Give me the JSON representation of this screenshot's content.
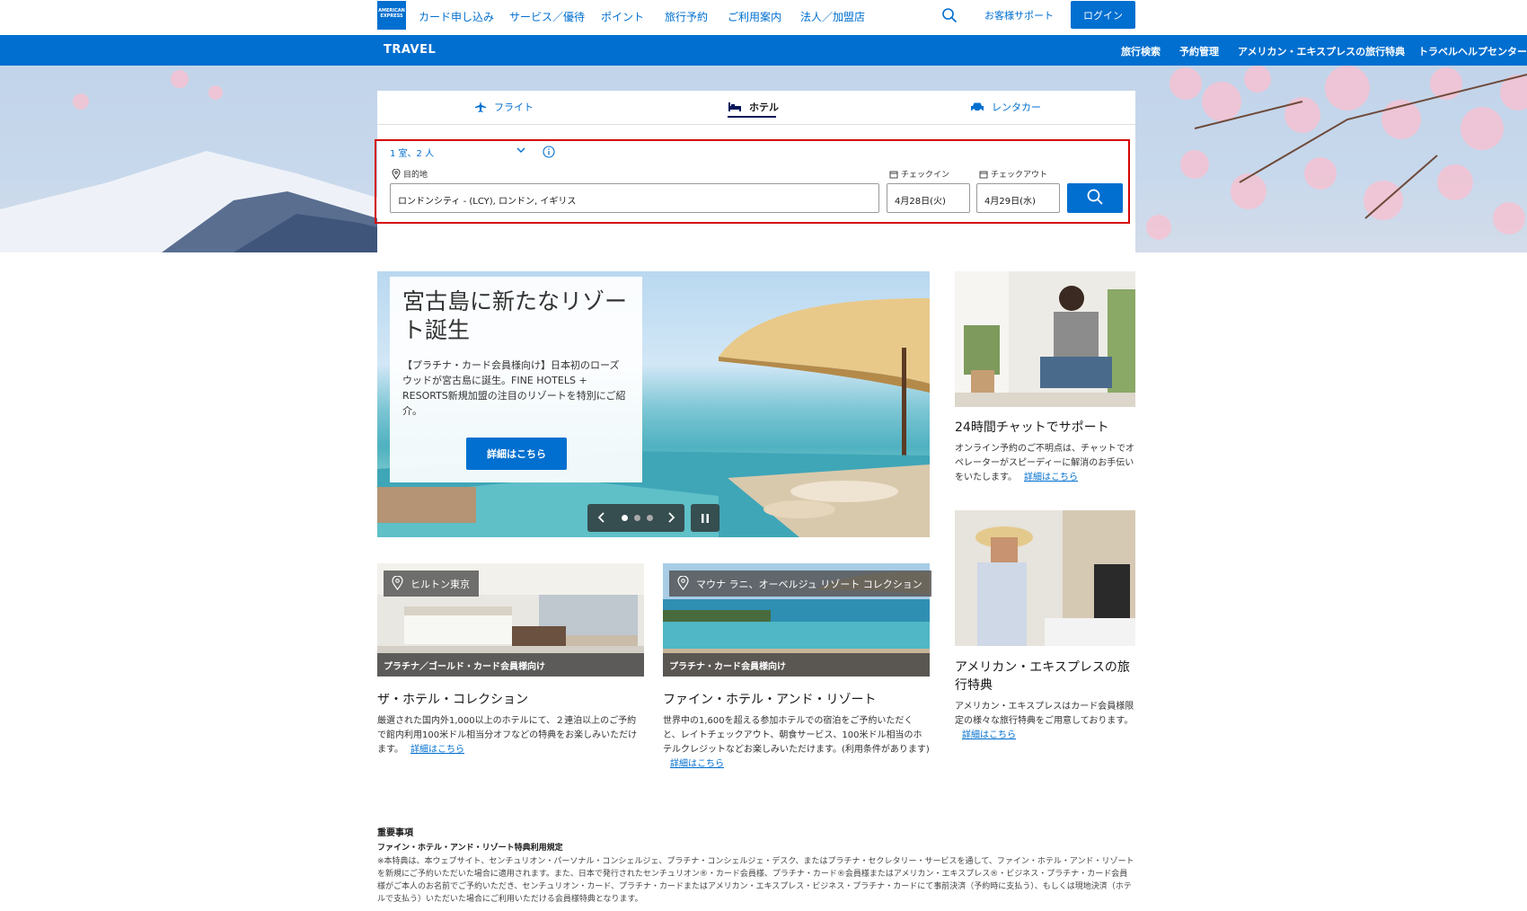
{
  "topnav": {
    "logo_text": "AMERICAN EXPRESS",
    "items": [
      "カード申し込み",
      "サービス／優待",
      "ポイント",
      "旅行予約",
      "ご利用案内",
      "法人／加盟店"
    ],
    "support": "お客様サポート",
    "login": "ログイン"
  },
  "travelbar": {
    "title": "TRAVEL",
    "items": [
      "旅行検索",
      "予約管理",
      "アメリカン・エキスプレスの旅行特典",
      "トラベルヘルプセンター"
    ]
  },
  "search": {
    "tabs": [
      {
        "label": "フライト",
        "icon": "airplane-icon"
      },
      {
        "label": "ホテル",
        "icon": "bed-icon"
      },
      {
        "label": "レンタカー",
        "icon": "car-icon"
      }
    ],
    "active_tab": "ホテル",
    "rooms_guests": "1 室、2 人",
    "destination_label": "目的地",
    "destination_value": "ロンドンシティ - (LCY), ロンドン, イギリス",
    "checkin_label": "チェックイン",
    "checkin_value": "4月28日(火)",
    "checkout_label": "チェックアウト",
    "checkout_value": "4月29日(水)"
  },
  "feature": {
    "title": "宮古島に新たなリゾート誕生",
    "description": "【プラチナ・カード会員様向け】日本初のローズウッドが宮古島に誕生。FINE HOTELS + RESORTS新規加盟の注目のリゾートを特別にご紹介。",
    "button": "詳細はこちら",
    "slides": 3,
    "current_slide": 1
  },
  "cards": [
    {
      "tag": "ヒルトン東京",
      "band": "プラチナ／ゴールド・カード会員様向け",
      "title": "ザ・ホテル・コレクション",
      "desc": "厳選された国内外1,000以上のホテルにて、２連泊以上のご予約で館内利用100米ドル相当分オフなどの特典をお楽しみいただけます。",
      "link": "詳細はこちら"
    },
    {
      "tag": "マウナ ラニ、オーベルジュ リゾート コレクション",
      "band": "プラチナ・カード会員様向け",
      "title": "ファイン・ホテル・アンド・リゾート",
      "desc": "世界中の1,600を超える参加ホテルでの宿泊をご予約いただくと、レイトチェックアウト、朝食サービス、100米ドル相当のホテルクレジットなどお楽しみいただけます。(利用条件があります)",
      "link": "詳細はこちら"
    }
  ],
  "side": [
    {
      "title": "24時間チャットでサポート",
      "desc": "オンライン予約のご不明点は、チャットでオペレーターがスピーディーに解消のお手伝いをいたします。",
      "link": "詳細はこちら"
    },
    {
      "title": "アメリカン・エキスプレスの旅行特典",
      "desc": "アメリカン・エキスプレスはカード会員様限定の様々な旅行特典をご用意しております。",
      "link": "詳細はこちら"
    }
  ],
  "notes": {
    "heading": "重要事項",
    "subheading": "ファイン・ホテル・アンド・リゾート特典利用規定",
    "body": "※本特典は、本ウェブサイト、センチュリオン・パーソナル・コンシェルジェ、プラチナ・コンシェルジェ・デスク、またはプラチナ・セクレタリー・サービスを通して、ファイン・ホテル・アンド・リゾートを新規にご予約いただいた場合に適用されます。また、日本で発行されたセンチュリオン®・カード会員様、プラチナ・カード®会員様またはアメリカン・エキスプレス®・ビジネス・プラチナ・カード会員様がご本人のお名前でご予約いただき、センチュリオン・カード、プラチナ・カードまたはアメリカン・エキスプレス・ビジネス・プラチナ・カードにて事前決済（予約時に支払う）、もしくは現地決済（ホテルで支払う）いただいた場合にご利用いただける会員様特典となります。"
  },
  "colors": {
    "brand_blue": "#006fcf",
    "highlight_red": "#d40000"
  }
}
